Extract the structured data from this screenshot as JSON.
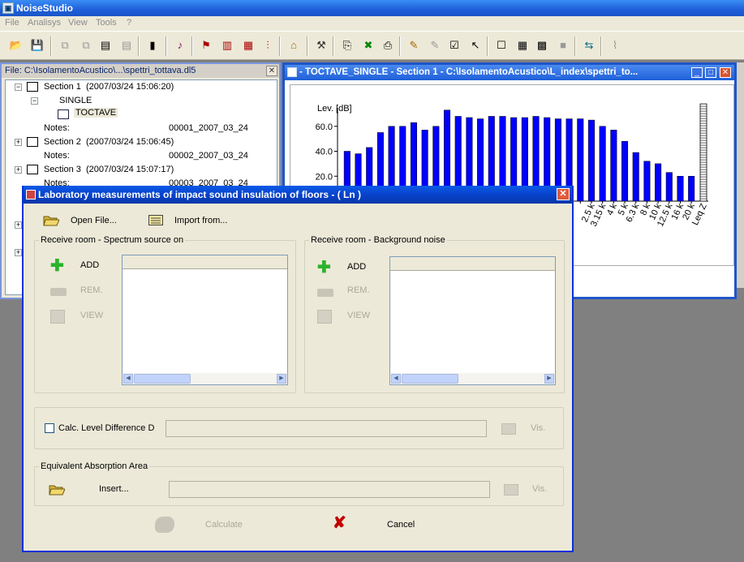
{
  "app": {
    "title": "NoiseStudio"
  },
  "menu": [
    "File",
    "Analisys",
    "View",
    "Tools",
    "?"
  ],
  "file_window": {
    "title": "File: C:\\IsolamentoAcustico\\...\\spettri_tottava.dl5",
    "sections": [
      {
        "label": "Section 1",
        "date": "(2007/03/24 15:06:20)",
        "notes_label": "Notes:",
        "notes_value": "00001_2007_03_24"
      },
      {
        "label": "Section 2",
        "date": "(2007/03/24 15:06:45)",
        "notes_label": "Notes:",
        "notes_value": "00002_2007_03_24"
      },
      {
        "label": "Section 3",
        "date": "(2007/03/24 15:07:17)",
        "notes_label": "Notes:",
        "notes_value": "00003_2007_03_24"
      }
    ],
    "single_label": "SINGLE",
    "toctave_label": "TOCTAVE"
  },
  "chart_window": {
    "title": "- TOCTAVE_SINGLE - Section 1 -  C:\\IsolamentoAcustico\\L_index\\spettri_to..."
  },
  "chart_data": {
    "type": "bar",
    "ylabel": "Lev. [dB]",
    "yticks": [
      "60.0",
      "40.0",
      "20.0"
    ],
    "ylim": [
      0,
      80
    ],
    "bar_color": "#0000ff",
    "values": [
      40,
      38,
      43,
      55,
      60,
      60,
      63,
      57,
      60,
      73,
      68,
      67,
      66,
      68,
      68,
      67,
      67,
      68,
      67,
      66,
      66,
      66,
      65,
      60,
      57,
      48,
      39,
      32,
      30,
      23,
      20,
      20
    ],
    "visible_xlabels": [
      "2.5 k",
      "3.15 k",
      "4 k",
      "5 k",
      "6.3 k",
      "8 k",
      "10 k",
      "12.5 k",
      "16 k",
      "20 k",
      "Leq Z"
    ],
    "leq_bar_value": 78
  },
  "dialog": {
    "title": "Laboratory measurements of impact sound insulation of floors - ( Ln )",
    "open_file": "Open File...",
    "import_from": "Import from...",
    "spectrum_group": {
      "title": "Receive room - Spectrum source on",
      "add": "ADD",
      "rem": "REM.",
      "view": "VIEW"
    },
    "background_group": {
      "title": "Receive room - Background noise",
      "add": "ADD",
      "rem": "REM.",
      "view": "VIEW"
    },
    "calc_level_diff": "Calc. Level Difference D",
    "vis_label": "Vis.",
    "absorption_group": {
      "title": "Equivalent Absorption Area",
      "insert": "Insert...",
      "vis_label": "Vis."
    },
    "calculate": "Calculate",
    "cancel": "Cancel"
  },
  "colors": {
    "xp_blue": "#0a5ae8",
    "dialog_bg": "#ece9d8",
    "disabled": "#aca899",
    "add_green": "#2bb32b",
    "cancel_red": "#c00000"
  }
}
